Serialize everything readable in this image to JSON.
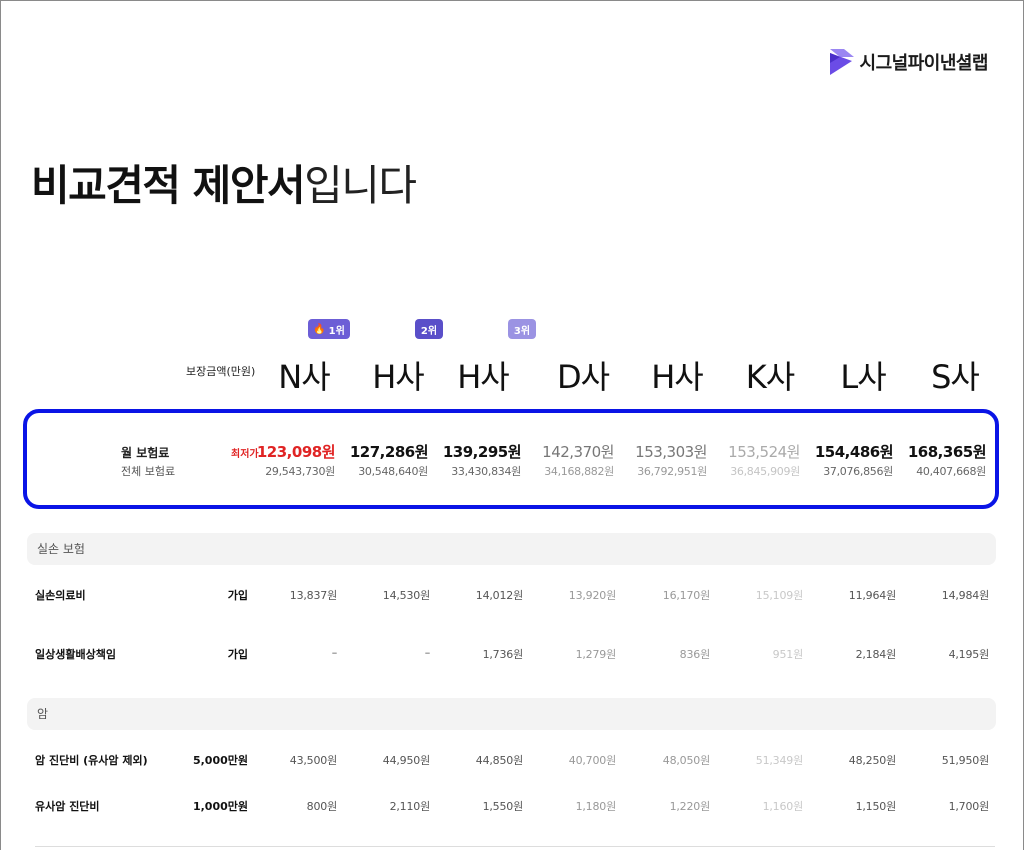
{
  "brand": {
    "name": "시그널파이낸셜랩",
    "logo_icon": "signal-logo-icon",
    "logo_color": "#6b4ce6"
  },
  "title": {
    "bold": "비교견적 제안서",
    "light": "입니다"
  },
  "header": {
    "coverage_label": "보장금액(만원)",
    "ranks": [
      {
        "icon": "fire-icon",
        "icon_glyph": "🔥",
        "label": "1위"
      },
      {
        "label": "2위"
      },
      {
        "label": "3위"
      }
    ],
    "companies": [
      "N사",
      "H사",
      "H사",
      "D사",
      "H사",
      "K사",
      "L사",
      "S사"
    ]
  },
  "premium": {
    "monthly_label": "월 보험료",
    "total_label": "전체 보험료",
    "lowest_badge": "최저가",
    "highlight_color": "#0a14e6",
    "lowest_color": "#e02424",
    "monthly": [
      "123,098원",
      "127,286원",
      "139,295원",
      "142,370원",
      "153,303원",
      "153,524원",
      "154,486원",
      "168,365원"
    ],
    "total": [
      "29,543,730원",
      "30,548,640원",
      "33,430,834원",
      "34,168,882원",
      "36,792,951원",
      "36,845,909원",
      "37,076,856원",
      "40,407,668원"
    ]
  },
  "sections": [
    {
      "title": "실손 보험",
      "rows": [
        {
          "label": "실손의료비",
          "amount": "가입",
          "values": [
            "13,837원",
            "14,530원",
            "14,012원",
            "13,920원",
            "16,170원",
            "15,109원",
            "11,964원",
            "14,984원"
          ]
        },
        {
          "label": "일상생활배상책임",
          "amount": "가입",
          "values": [
            "–",
            "–",
            "1,736원",
            "1,279원",
            "836원",
            "951원",
            "2,184원",
            "4,195원"
          ]
        }
      ]
    },
    {
      "title": "암",
      "rows": [
        {
          "label": "암 진단비 (유사암 제외)",
          "amount": "5,000만원",
          "values": [
            "43,500원",
            "44,950원",
            "44,850원",
            "40,700원",
            "48,050원",
            "51,349원",
            "48,250원",
            "51,950원"
          ]
        },
        {
          "label": "유사암 진단비",
          "amount": "1,000만원",
          "values": [
            "800원",
            "2,110원",
            "1,550원",
            "1,180원",
            "1,220원",
            "1,160원",
            "1,150원",
            "1,700원"
          ]
        }
      ]
    }
  ]
}
